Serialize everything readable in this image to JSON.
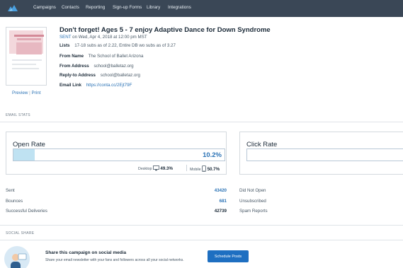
{
  "nav": {
    "items": [
      "Campaigns",
      "Contacts",
      "Reporting",
      "Sign-up Forms",
      "Library",
      "Integrations"
    ],
    "colors": {
      "bar": "#3a4756",
      "text": "#e7edf2",
      "logo": "#4aa0e0"
    }
  },
  "campaign": {
    "title": "Don't forget! Ages 5 - 7 enjoy Adaptive Dance for Down Syndrome",
    "status": "SENT",
    "sent_on": "on Wed, Apr 4, 2018 at 12:00 pm MST",
    "lists_label": "Lists",
    "lists_value": "17-18 subs as of 2.22, Entire DB wo subs as of 3.27",
    "from_name_label": "From Name",
    "from_name_value": "The School of Ballet Arizona",
    "from_address_label": "From Address",
    "from_address_value": "school@balletaz.org",
    "reply_to_label": "Reply-to Address",
    "reply_to_value": "school@balletaz.org",
    "email_link_label": "Email Link",
    "email_link_value": "https://conta.cc/2Ejt79F",
    "preview_label": "Preview",
    "print_label": "Print",
    "separator": "|"
  },
  "email_stats": {
    "section_label": "EMAIL STATS",
    "open_rate": {
      "label": "Open Rate",
      "percent_text": "10.2%",
      "fill_fraction": 0.102,
      "desktop_label": "Desktop",
      "desktop_pct": "49.3%",
      "mobile_label": "Mobile",
      "mobile_pct": "50.7%"
    },
    "click_rate": {
      "label": "Click Rate"
    },
    "rows": [
      {
        "label": "Sent",
        "value": "43420",
        "link": true
      },
      {
        "label": "Bounces",
        "value": "681",
        "link": true
      },
      {
        "label": "Successful Deliveries",
        "value": "42739",
        "link": false
      }
    ],
    "right_rows": [
      "Did Not Open",
      "Unsubscribed",
      "Spam Reports"
    ],
    "colors": {
      "accent": "#2a72b5",
      "bar_fill": "#bfe2f2"
    }
  },
  "social_share": {
    "section_label": "SOCIAL SHARE",
    "title": "Share this campaign on social media",
    "subtitle": "Share your email newsletter with your fans and followers across all your social networks.",
    "button_label": "Schedule Posts",
    "colors": {
      "button": "#1e6fc1"
    }
  }
}
